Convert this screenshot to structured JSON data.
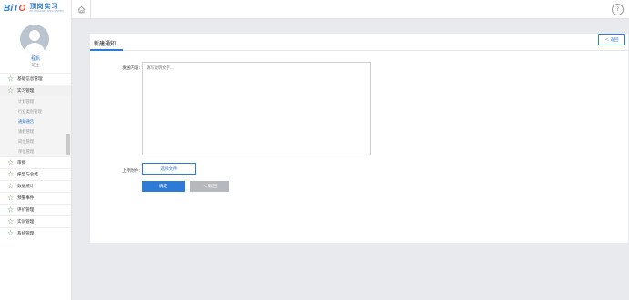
{
  "brand": {
    "logo_mark_a": "BiT",
    "logo_mark_b": "O",
    "name_cn": "顶岗实习",
    "name_en": "BIT DINGGANG SHIXI SYSTEM"
  },
  "user": {
    "name": "程帆",
    "role": "班主"
  },
  "sidebar": {
    "items": [
      {
        "label": "基础信息管理"
      },
      {
        "label": "实习管理",
        "active": true
      },
      {
        "label": "审批"
      },
      {
        "label": "报告与总结"
      },
      {
        "label": "数据统计"
      },
      {
        "label": "预警事件"
      },
      {
        "label": "评价管理"
      },
      {
        "label": "实训管理"
      },
      {
        "label": "系统管理"
      }
    ],
    "subitems": [
      {
        "label": "计划管理"
      },
      {
        "label": "行业类别管理"
      },
      {
        "label": "通知通告",
        "active": true
      },
      {
        "label": "请假管理"
      },
      {
        "label": "岗位管理"
      },
      {
        "label": "单位管理"
      }
    ]
  },
  "topbar": {
    "home_icon": "home-icon",
    "help_label": "?"
  },
  "page": {
    "title": "新建通知",
    "back_top_label": "＜ 返回",
    "content_label": "发送内容:",
    "content_placeholder": "请写说明文字...",
    "attach_label": "上传附件:",
    "file_button": "选择文件",
    "ok_button": "确定",
    "back_button": "＜ 返回"
  },
  "colors": {
    "accent": "#2d7bd6",
    "star": "#6b9a6b",
    "bg": "#e9eaee"
  }
}
